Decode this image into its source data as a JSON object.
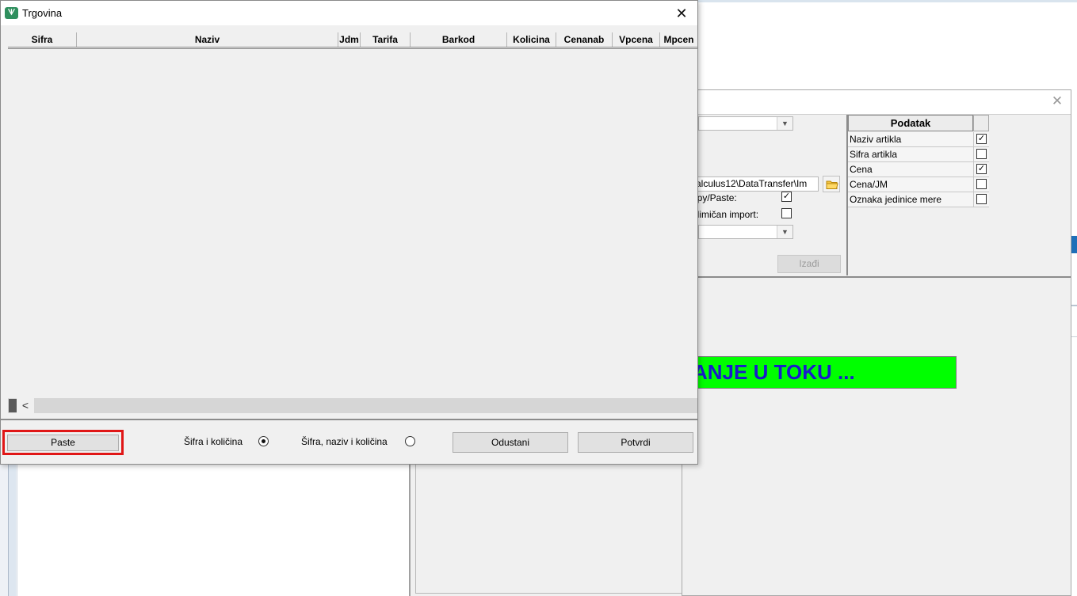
{
  "main_dialog": {
    "title": "Trgovina",
    "close_glyph": "✕",
    "icon": "app-logo-icon",
    "columns": [
      "Sifra",
      "Naziv",
      "Jdm",
      "Tarifa",
      "Barkod",
      "Kolicina",
      "Cenanab",
      "Vpcena",
      "Mpcen"
    ],
    "scroll_left_glyph": "<",
    "paste_label": "Paste",
    "radio_options": [
      {
        "label": "Šifra i količina",
        "selected": true
      },
      {
        "label": "Šifra, naziv i količina",
        "selected": false
      }
    ],
    "cancel_label": "Odustani",
    "confirm_label": "Potvrdi",
    "highlight_color": "#e01616"
  },
  "import_dialog": {
    "close_glyph": "✕",
    "path_value": "alculus12\\DataTransfer\\Im",
    "options": [
      {
        "label": "opy/Paste:",
        "checked": true
      },
      {
        "label": "elimičan import:",
        "checked": false
      }
    ],
    "exit_label": "Izađi",
    "table_header": "Podatak",
    "fields": [
      {
        "label": "Naziv artikla",
        "checked": true
      },
      {
        "label": "Sifra artikla",
        "checked": false
      },
      {
        "label": "Cena",
        "checked": true
      },
      {
        "label": "Cena/JM",
        "checked": false
      },
      {
        "label": "Oznaka jedinice mere",
        "checked": false
      }
    ],
    "progress_text": "ANJE U TOKU ...",
    "progress_bg": "#00ff00",
    "progress_fg": "#1a1acc"
  }
}
